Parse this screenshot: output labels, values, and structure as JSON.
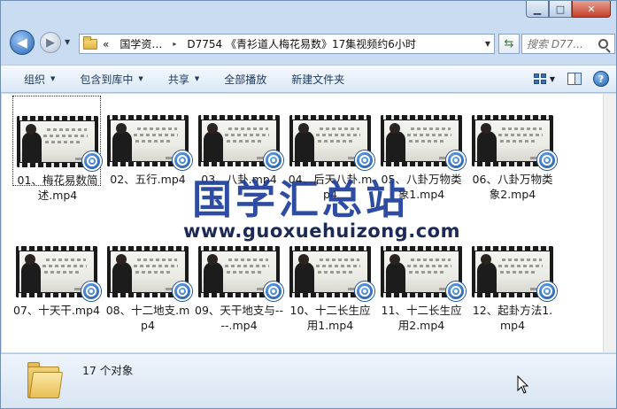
{
  "window": {
    "caption": {
      "minimize": "▁",
      "maximize": "□",
      "close": "✕"
    }
  },
  "address": {
    "crumbs": [
      "«",
      "国学资…",
      "▸",
      "D7754 《青衫道人梅花易数》17集视频约6小时"
    ],
    "search_placeholder": "搜索 D77..."
  },
  "toolbar": {
    "items": [
      {
        "label": "组织",
        "dropdown": true
      },
      {
        "label": "包含到库中",
        "dropdown": true
      },
      {
        "label": "共享",
        "dropdown": true
      },
      {
        "label": "全部播放",
        "dropdown": false
      },
      {
        "label": "新建文件夹",
        "dropdown": false
      }
    ],
    "help": "?"
  },
  "files": [
    {
      "name": "01、梅花易数简述.mp4",
      "selected": true
    },
    {
      "name": "02、五行.mp4",
      "selected": false
    },
    {
      "name": "03、八卦.mp4",
      "selected": false
    },
    {
      "name": "04、后天八卦.mp4",
      "selected": false
    },
    {
      "name": "05、八卦万物类象1.mp4",
      "selected": false
    },
    {
      "name": "06、八卦万物类象2.mp4",
      "selected": false
    },
    {
      "name": "07、十天干.mp4",
      "selected": false
    },
    {
      "name": "08、十二地支.mp4",
      "selected": false
    },
    {
      "name": "09、天干地支与----.mp4",
      "selected": false
    },
    {
      "name": "10、十二长生应用1.mp4",
      "selected": false
    },
    {
      "name": "11、十二长生应用2.mp4",
      "selected": false
    },
    {
      "name": "12、起卦方法1.mp4",
      "selected": false
    }
  ],
  "watermark": {
    "title": "国学汇总站",
    "url": "www.guoxuehuizong.com"
  },
  "details": {
    "count": "17 个对象"
  },
  "colors": {
    "window_frame": "#c9dcf2",
    "watermark": "#1f3f9a",
    "command_bar": "#dbe8f6"
  }
}
